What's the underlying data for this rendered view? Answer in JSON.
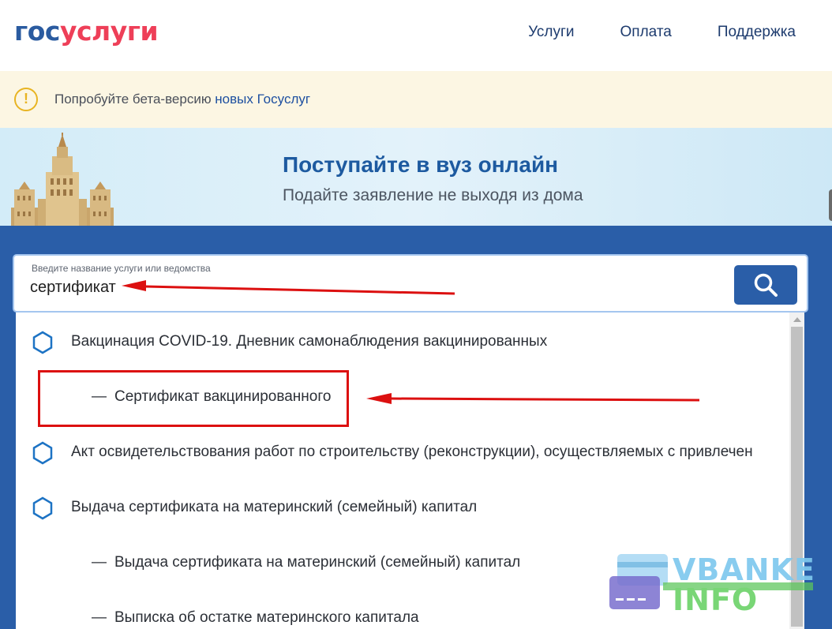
{
  "header": {
    "logo_part1": "гос",
    "logo_part2": "услуги",
    "nav": [
      "Услуги",
      "Оплата",
      "Поддержка"
    ]
  },
  "beta_banner": {
    "text": "Попробуйте бета-версию ",
    "link": "новых Госуслуг"
  },
  "promo": {
    "title": "Поступайте в вуз онлайн",
    "subtitle": "Подайте заявление не выходя из дома"
  },
  "search": {
    "label": "Введите название услуги или ведомства",
    "value": "сертификат"
  },
  "results": [
    {
      "text": "Вакцинация COVID-19. Дневник самонаблюдения вакцинированных",
      "type": "service"
    },
    {
      "text": "Сертификат вакцинированного",
      "type": "sub"
    },
    {
      "text": "Акт освидетельствования работ по строительству (реконструкции), осуществляемых с привлечен",
      "type": "service"
    },
    {
      "text": "Выдача сертификата на материнский (семейный) капитал",
      "type": "service"
    },
    {
      "text": "Выдача сертификата на материнский (семейный) капитал",
      "type": "sub"
    },
    {
      "text": "Выписка об остатке материнского капитала",
      "type": "sub"
    }
  ],
  "watermark": {
    "line1": "VBANKE",
    "line2": "INFO"
  },
  "colors": {
    "brand_blue": "#2a5ea8",
    "brand_red": "#ee3f58",
    "annotation_red": "#dc1010",
    "beta_bg": "#fcf6e3"
  }
}
